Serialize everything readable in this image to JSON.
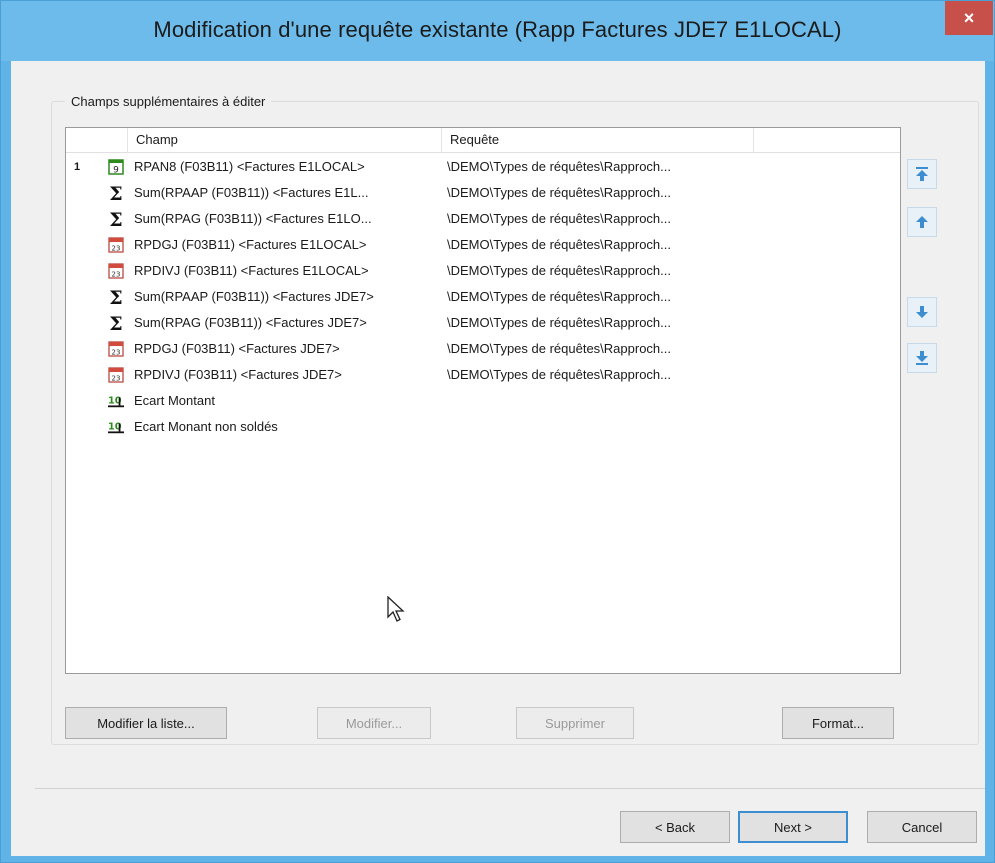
{
  "window": {
    "title": "Modification d'une requête existante (Rapp Factures JDE7 E1LOCAL)",
    "close": "×"
  },
  "group": {
    "label": "Champs supplémentaires à éditer"
  },
  "list": {
    "columns": [
      "Champ",
      "Requête"
    ],
    "rows": [
      {
        "num": "1",
        "icon": "number-field-icon",
        "champ": "RPAN8 (F03B11) <Factures E1LOCAL>",
        "requete": "\\DEMO\\Types de réquêtes\\Rapproch..."
      },
      {
        "num": "",
        "icon": "sum-icon",
        "champ": "Sum(RPAAP (F03B11)) <Factures E1L...",
        "requete": "\\DEMO\\Types de réquêtes\\Rapproch..."
      },
      {
        "num": "",
        "icon": "sum-icon",
        "champ": "Sum(RPAG (F03B11)) <Factures E1LO...",
        "requete": "\\DEMO\\Types de réquêtes\\Rapproch..."
      },
      {
        "num": "",
        "icon": "date-field-icon",
        "champ": "RPDGJ (F03B11) <Factures E1LOCAL>",
        "requete": "\\DEMO\\Types de réquêtes\\Rapproch..."
      },
      {
        "num": "",
        "icon": "date-field-icon",
        "champ": "RPDIVJ (F03B11) <Factures E1LOCAL>",
        "requete": "\\DEMO\\Types de réquêtes\\Rapproch..."
      },
      {
        "num": "",
        "icon": "sum-icon",
        "champ": "Sum(RPAAP (F03B11)) <Factures JDE7>",
        "requete": "\\DEMO\\Types de réquêtes\\Rapproch..."
      },
      {
        "num": "",
        "icon": "sum-icon",
        "champ": "Sum(RPAG (F03B11)) <Factures JDE7>",
        "requete": "\\DEMO\\Types de réquêtes\\Rapproch..."
      },
      {
        "num": "",
        "icon": "date-field-icon",
        "champ": "RPDGJ (F03B11) <Factures JDE7>",
        "requete": "\\DEMO\\Types de réquêtes\\Rapproch..."
      },
      {
        "num": "",
        "icon": "date-field-icon",
        "champ": "RPDIVJ (F03B11) <Factures JDE7>",
        "requete": "\\DEMO\\Types de réquêtes\\Rapproch..."
      },
      {
        "num": "",
        "icon": "calculated-field-icon",
        "champ": "Ecart Montant",
        "requete": ""
      },
      {
        "num": "",
        "icon": "calculated-field-icon",
        "champ": "Ecart Monant non soldés",
        "requete": ""
      }
    ]
  },
  "move_buttons": [
    {
      "name": "move-top-button",
      "icon": "arrow-top-icon"
    },
    {
      "name": "move-up-button",
      "icon": "arrow-up-icon"
    },
    {
      "name": "move-down-button",
      "icon": "arrow-down-icon"
    },
    {
      "name": "move-bottom-button",
      "icon": "arrow-bottom-icon"
    }
  ],
  "buttons": {
    "modify_list": "Modifier la liste...",
    "modify": "Modifier...",
    "delete": "Supprimer",
    "format": "Format...",
    "back": "< Back",
    "next": "Next >",
    "cancel": "Cancel"
  },
  "colors": {
    "title_bar": "#6cbbea",
    "close_button": "#c7504a",
    "accent": "#3c8ed0",
    "calc_icon": "#2f8a1e"
  }
}
